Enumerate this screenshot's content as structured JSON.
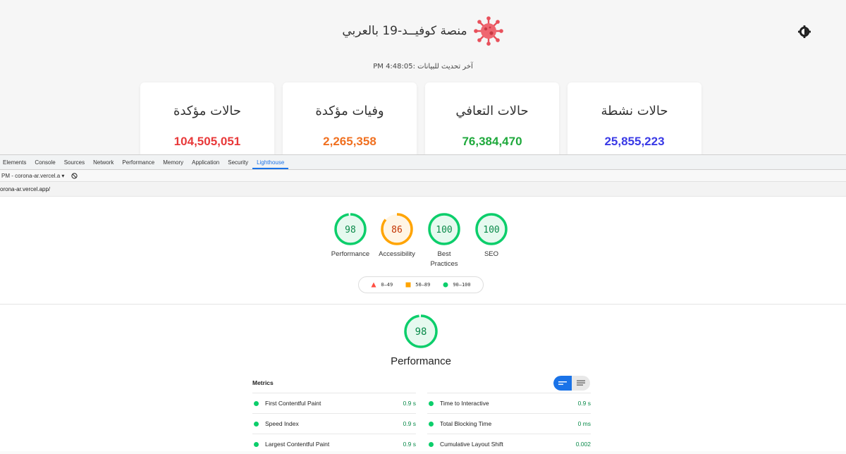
{
  "app": {
    "title": "منصة كوفيــد-19 بالعربي",
    "last_updated": "آخر تحديث للبيانات :4:48:05 PM",
    "cards": [
      {
        "title": "حالات نشطة",
        "value": "25,855,223",
        "color": "#3a3ae6"
      },
      {
        "title": "حالات التعافي",
        "value": "76,384,470",
        "color": "#1fa93c"
      },
      {
        "title": "وفيات مؤكدة",
        "value": "2,265,358",
        "color": "#f07020"
      },
      {
        "title": "حالات مؤكدة",
        "value": "104,505,051",
        "color": "#e8393a"
      }
    ]
  },
  "devtools": {
    "tabs": [
      "Elements",
      "Console",
      "Sources",
      "Network",
      "Performance",
      "Memory",
      "Application",
      "Security",
      "Lighthouse"
    ],
    "active_tab": "Lighthouse",
    "report_select": "PM - corona-ar.vercel.a",
    "url": "orona-ar.vercel.app/"
  },
  "lighthouse": {
    "categories": [
      {
        "score": "98",
        "label": "Performance",
        "color": "#0cce6b",
        "fill": 0.98
      },
      {
        "score": "86",
        "label": "Accessibility",
        "color": "#ffa400",
        "fill": 0.86
      },
      {
        "score": "100",
        "label": "Best Practices",
        "color": "#0cce6b",
        "fill": 1.0
      },
      {
        "score": "100",
        "label": "SEO",
        "color": "#0cce6b",
        "fill": 1.0
      }
    ],
    "legend": [
      {
        "range": "0–49",
        "color": "#ff4e42",
        "shape": "triangle"
      },
      {
        "range": "50–89",
        "color": "#ffa400",
        "shape": "square"
      },
      {
        "range": "90–100",
        "color": "#0cce6b",
        "shape": "circle"
      }
    ],
    "performance": {
      "score": "98",
      "title": "Performance",
      "fill": 0.98,
      "metrics_heading": "Metrics",
      "metrics_left": [
        {
          "name": "First Contentful Paint",
          "value": "0.9 s"
        },
        {
          "name": "Speed Index",
          "value": "0.9 s"
        },
        {
          "name": "Largest Contentful Paint",
          "value": "0.9 s"
        }
      ],
      "metrics_right": [
        {
          "name": "Time to Interactive",
          "value": "0.9 s"
        },
        {
          "name": "Total Blocking Time",
          "value": "0 ms"
        },
        {
          "name": "Cumulative Layout Shift",
          "value": "0.002"
        }
      ]
    }
  }
}
